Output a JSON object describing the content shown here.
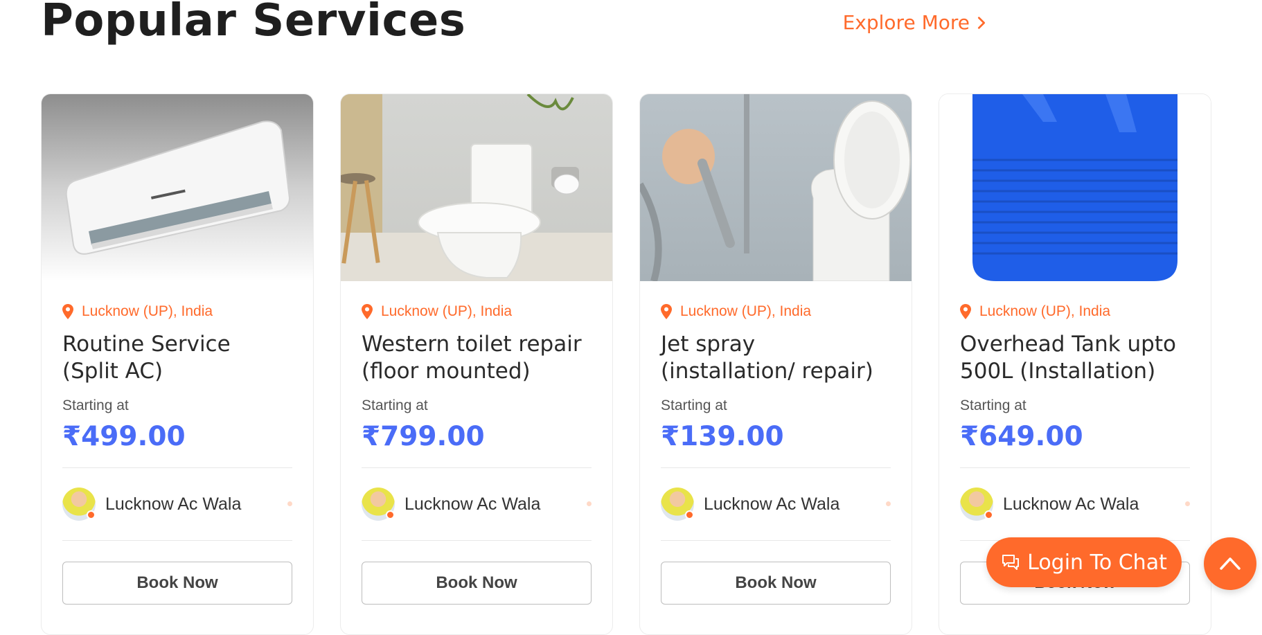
{
  "section": {
    "title": "Popular Services",
    "explore_label": "Explore More"
  },
  "cards": [
    {
      "location": "Lucknow (UP), India",
      "title": "Routine Service (Split AC)",
      "starting_label": "Starting at",
      "price": "₹499.00",
      "provider": "Lucknow Ac Wala",
      "button": "Book Now",
      "image": "split-ac-unit"
    },
    {
      "location": "Lucknow (UP), India",
      "title": "Western toilet repair (floor mounted)",
      "starting_label": "Starting at",
      "price": "₹799.00",
      "provider": "Lucknow Ac Wala",
      "button": "Book Now",
      "image": "western-toilet"
    },
    {
      "location": "Lucknow (UP), India",
      "title": "Jet spray (installation/ repair)",
      "starting_label": "Starting at",
      "price": "₹139.00",
      "provider": "Lucknow Ac Wala",
      "button": "Book Now",
      "image": "jet-spray"
    },
    {
      "location": "Lucknow (UP), India",
      "title": "Overhead Tank upto 500L (Installation)",
      "starting_label": "Starting at",
      "price": "₹649.00",
      "provider": "Lucknow Ac Wala",
      "button": "Book Now",
      "image": "water-tank"
    }
  ],
  "chat": {
    "label": "Login To Chat"
  },
  "colors": {
    "accent": "#ff6a2b",
    "price": "#4a6cf7",
    "tank": "#1f5ee8"
  }
}
